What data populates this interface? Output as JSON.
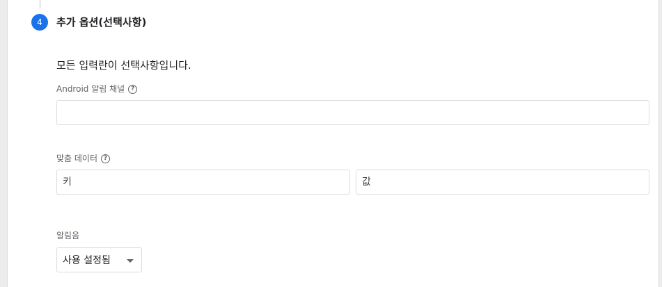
{
  "step": {
    "number": "4",
    "title": "추가 옵션(선택사항)"
  },
  "intro_text": "모든 입력란이 선택사항입니다.",
  "android_channel": {
    "label": "Android 알림 채널",
    "value": "",
    "placeholder": ""
  },
  "custom_data": {
    "label": "맞춤 데이터",
    "key_placeholder": "키",
    "value_placeholder": "값"
  },
  "sound": {
    "label": "알림음",
    "selected": "사용 설정됨"
  },
  "help_glyph": "?",
  "colors": {
    "accent": "#1a73e8",
    "border": "#dadce0"
  }
}
